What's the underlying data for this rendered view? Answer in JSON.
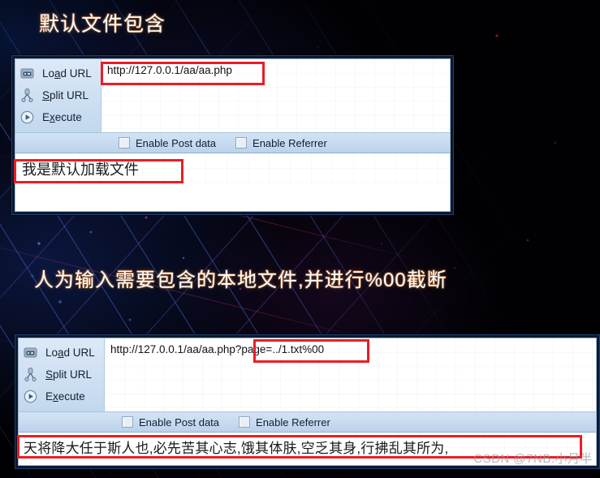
{
  "headings": {
    "section_1": "默认文件包含",
    "section_2": "人为输入需要包含的本地文件,并进行%00截断"
  },
  "toolbar": {
    "items": [
      {
        "label_pre": "Lo",
        "label_accel": "a",
        "label_post": "d URL",
        "icon": "load-url-icon"
      },
      {
        "label_pre": "",
        "label_accel": "S",
        "label_post": "plit URL",
        "icon": "split-url-icon"
      },
      {
        "label_pre": "E",
        "label_accel": "x",
        "label_post": "ecute",
        "icon": "execute-play-icon"
      }
    ]
  },
  "checkboxes": {
    "post_data": "Enable Post data",
    "referrer": "Enable Referrer",
    "post_data_checked": false,
    "referrer_checked": false
  },
  "panel_1": {
    "url_base": "http://127.0.0.1/aa/aa.php",
    "url_param": "",
    "url_full": "http://127.0.0.1/aa/aa.php",
    "result": "我是默认加载文件"
  },
  "panel_2": {
    "url_base": "http://127.0.0.1/aa/aa.php",
    "url_param": "?page=../1.txt%00",
    "url_full": "http://127.0.0.1/aa/aa.php?page=../1.txt%00",
    "result": "天将降大任于斯人也,必先苦其心志,饿其体肤,空乏其身,行拂乱其所为,"
  },
  "watermark": "CSDN @7NB.小月半",
  "colors": {
    "annotation_red": "#ec1c24",
    "toolbar_blue": "#cfe0f3",
    "panel_border_navy": "#20406e",
    "background_black": "#010104"
  }
}
